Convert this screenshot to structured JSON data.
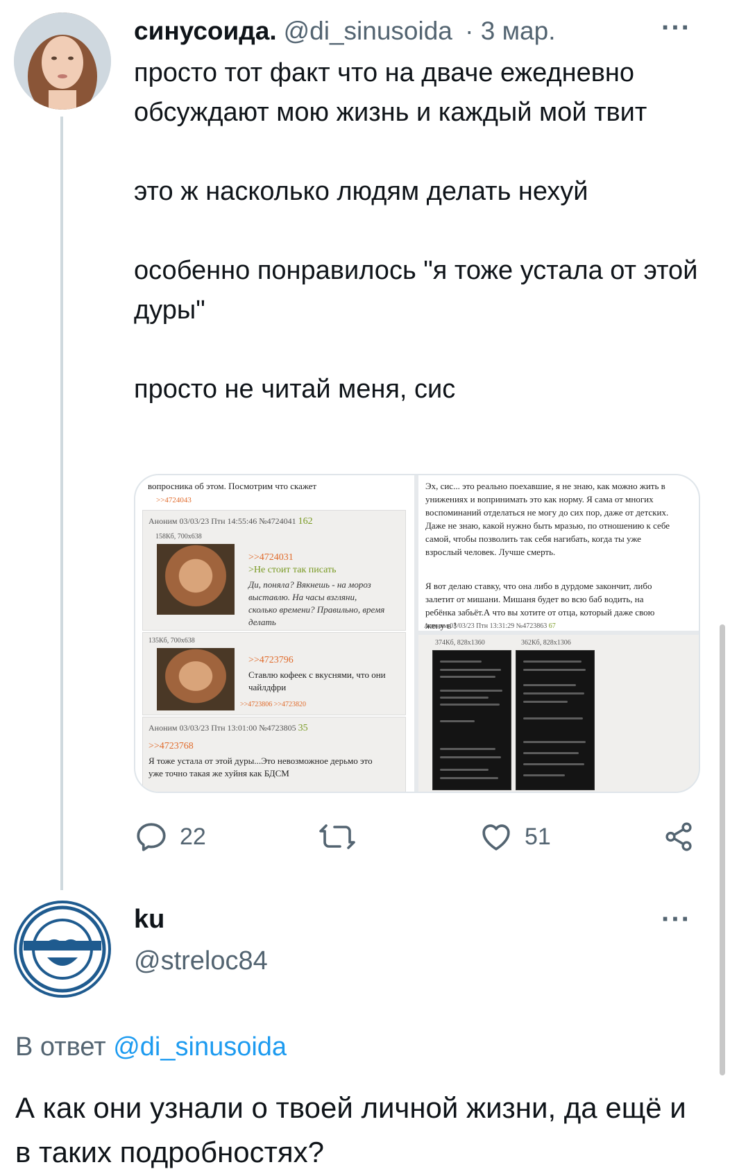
{
  "tweet": {
    "author_name": "синусоида.",
    "handle": "@di_sinusoida",
    "date": "· 3 мар.",
    "more": "···",
    "paragraphs": [
      "просто тот факт что на дваче ежедневно обсуждают мою жизнь и каждый мой твит",
      "это ж насколько людям делать нехуй",
      "особенно понравилось \"я тоже устала от этой дуры\"",
      "просто не читай меня, сис"
    ],
    "media": {
      "left_top": {
        "intro": "вопросника об этом. Посмотрим что скажет",
        "intro_ref": ">>4724043",
        "post1_meta": "Аноним 03/03/23 Птн 14:55:46 №4724041",
        "post1_count": "162",
        "post1_img_meta": "158Кб, 700x638",
        "post1_ref": ">>4724031",
        "post1_quote": ">Не стоит так писать",
        "post1_text": "Ди, поняла? Вякнешь - на мороз выставлю. На часы взгляни, сколько времени? Правильно, время делать",
        "post2_img_meta": "135Кб, 700x638",
        "post2_ref": ">>4723796",
        "post2_text": "Ставлю кофеек с вкуснями, что они чайлдфри",
        "post2_replies": ">>4723806 >>4723820",
        "post3_meta": "Аноним 03/03/23 Птн 13:01:00 №4723805",
        "post3_count": "35",
        "post3_ref": ">>4723768",
        "post3_text": "Я тоже устала от этой дуры...Это невозможное дерьмо это уже точно такая же хуйня как БДСМ"
      },
      "right_top": {
        "text1": "Эх, сис... это реально поехавшие, я не знаю, как можно жить в унижениях и вопринимать это как норму. Я сама от многих воспоминаний отделаться не могу до сих пор, даже от детских. Даже не знаю, какой нужно быть мразью, по отношению к себе самой, чтобы позволить так себя нагибать, когда ты уже взрослый человек. Лучше смерть.",
        "text2": "Я вот делаю ставку, что она либо в дурдоме закончит, либо залетит от мишани. Мишаня будет во всю баб водить, на ребёнка забьёт.А что вы хотите от отца, который даже свою жену в !",
        "meta": "Аноним 03/03/23 Птн 13:31:29 №4723863",
        "count": "67"
      },
      "right_bottom": {
        "img1_meta": "374Кб, 828x1360",
        "img2_meta": "362Кб, 828x1306"
      }
    },
    "actions": {
      "replies": "22",
      "likes": "51"
    }
  },
  "reply": {
    "author_name": "ku",
    "handle": "@streloc84",
    "more": "···",
    "reply_to_prefix": "В ответ",
    "reply_to_handle": "@di_sinusoida",
    "text": "А как они узнали о твоей личной жизни, да ещё и в таких подробностях?"
  },
  "colors": {
    "text": "#0f1419",
    "secondary": "#536471",
    "link": "#1d9bf0",
    "thread_line": "#cfd9de"
  },
  "icons": [
    "reply-icon",
    "retweet-icon",
    "like-icon",
    "share-icon",
    "more-icon"
  ]
}
